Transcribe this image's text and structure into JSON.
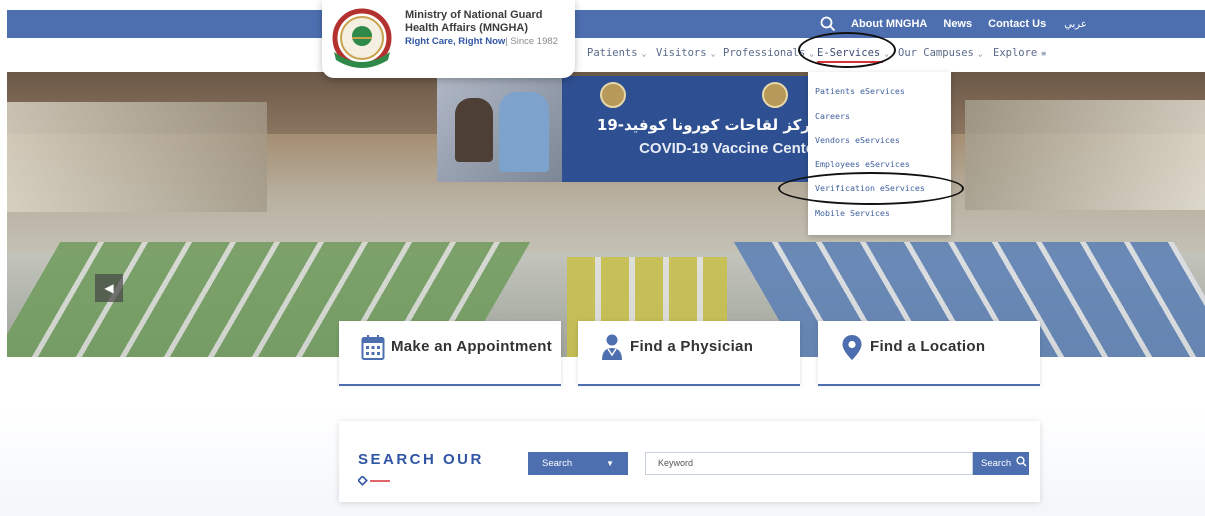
{
  "brand": {
    "line1": "Ministry of National Guard",
    "line2": "Health Affairs (MNGHA)",
    "tagline": "Right Care, Right Now",
    "since": "| Since 1982"
  },
  "topbar": {
    "about": "About MNGHA",
    "news": "News",
    "contact": "Contact Us",
    "language": "عربي",
    "icons": [
      "search-icon"
    ]
  },
  "nav": {
    "items": [
      {
        "label": "Patients"
      },
      {
        "label": "Visitors"
      },
      {
        "label": "Professionals"
      },
      {
        "label": "E-Services"
      },
      {
        "label": "Our Campuses"
      },
      {
        "label": "Explore"
      }
    ]
  },
  "hero": {
    "banner_ar": "مركز لقاحات كورونا كوفيد-19",
    "banner_en": "COVID-19 Vaccine Center"
  },
  "eservices_menu": {
    "items": [
      {
        "label": "Patients eServices"
      },
      {
        "label": "Careers"
      },
      {
        "label": "Vendors eServices"
      },
      {
        "label": "Employees eServices"
      },
      {
        "label": "Verification eServices"
      },
      {
        "label": "Mobile Services"
      }
    ]
  },
  "actions": {
    "appointment": "Make an Appointment",
    "physician": "Find a Physician",
    "location": "Find a Location"
  },
  "search": {
    "title": "SEARCH OUR",
    "select_value": "Search",
    "placeholder": "Keyword",
    "button": "Search"
  },
  "colors": {
    "primary": "#4d6fb0",
    "accent": "#d8323b",
    "link": "#3f5f9d"
  }
}
